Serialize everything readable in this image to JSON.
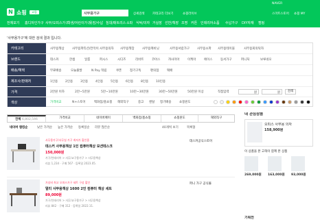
{
  "header": {
    "logo_letter": "N",
    "brand": "쇼핑",
    "badge": "쇼핑LIVE",
    "search_value": "사무용가구",
    "search_placeholder": "상품 검색",
    "links": [
      "상세검색",
      "카테고리 더보기",
      "쇼핑라이브",
      "스마트스토어"
    ],
    "user_links": [
      "NAVER",
      "쇼핑 MY"
    ]
  },
  "subnav": [
    "전체보기",
    "홈디자인가구",
    "사무/오피스가구",
    "학생/어린이가구",
    "옷장/수납",
    "침대/매트리스",
    "소파",
    "식탁/의자",
    "거실장",
    "선반/책장",
    "조명",
    "커튼",
    "인테리어소품",
    "수납가구",
    "DIY자재",
    "캠핑"
  ],
  "breadcrumb": "'사무용가구'에 대한 검색 결과 입니다.",
  "filters": [
    {
      "label": "카테고리",
      "options": [
        "사무용책상",
        "사무용파티션/칸막이",
        "사무용의자",
        "사무용책장",
        "사무용캐비닛",
        "사무용서랍가구",
        "사무용소파",
        "사무용테이블",
        "사무용회의탁자"
      ]
    },
    {
      "label": "브랜드",
      "options": [
        "데스커",
        "한샘",
        "일룸",
        "퍼시스",
        "시디즈",
        "리바트",
        "코아스",
        "까사미아",
        "이케아",
        "에이스",
        "동서가구",
        "퍼니처",
        "보루네오"
      ]
    },
    {
      "label": "배송/혜택",
      "options": [
        "무료배송",
        "오늘출발",
        "N Pay 적립",
        "쿠폰",
        "정기구독",
        "편의점",
        "택배"
      ]
    },
    {
      "label": "제조사/판매처",
      "options": [
        "1인용",
        "2인용",
        "3인용",
        "4인용",
        "5인용",
        "6인용",
        "8인용",
        "10인용"
      ]
    },
    {
      "label": "가격",
      "options": [
        "2만원 이하",
        "2만~5만원",
        "5만~10만원",
        "10만~30만원",
        "30만~50만원",
        "50만원 이상"
      ],
      "direct": "직접입력",
      "min": "원",
      "max": "원",
      "search": "검색"
    },
    {
      "label": "색상",
      "options": [
        "가격비교",
        "N+스토어",
        "백화점/홈쇼핑",
        "해외직구",
        "중고",
        "렌탈",
        "정기배송",
        "쇼핑윈도"
      ]
    }
  ],
  "colors": [
    "#ffffff",
    "#f2f2f2",
    "#ffd400",
    "#ff9900",
    "#ff0000",
    "#ff66cc",
    "#66cc33",
    "#009933",
    "#3399ff",
    "#0033cc",
    "#9933cc",
    "#663300",
    "#cc9966",
    "#999999",
    "#333333",
    "#000000"
  ],
  "tabs": [
    "전체",
    "가격비교",
    "네이버페이",
    "백화점/홈쇼핑",
    "쇼핑윈도",
    "해외직구"
  ],
  "tab_counts": [
    "6,802,546",
    "",
    "",
    "",
    "",
    ""
  ],
  "sort": [
    "네이버 랭킹순",
    "낮은 가격순",
    "높은 가격순",
    "등록일순",
    "리뷰 많은순"
  ],
  "view_options": [
    "40개씩 보기",
    "목록형"
  ],
  "items": [
    {
      "ad": "사무용가구/사무실 가구 최저가 할인중",
      "name": "데스커 사무용책상 1인 컴퓨터책상 모션데스크",
      "price": "150,000원",
      "cat": "가구/인테리어 > 사무/교구용가구 > 사무용책상",
      "meta": "리뷰 1,234 · 구매 567 · 등록일 2023.05.",
      "mall": "데스커공식스토어"
    },
    {
      "ad": "가성비 최고 오피스가구 세트 구성 할인",
      "name": "멀티 사무용책상 1600 2인 컴퓨터 책상 세트",
      "price": "89,000원",
      "cat": "가구/인테리어 > 사무/교구용가구 > 사무용책상",
      "meta": "리뷰 842 · 구매 312 · 등록일 2022.11.",
      "mall": "퍼니 가구 공식몰"
    }
  ],
  "right_panel": {
    "title": "내 관심상품",
    "product": "오피스 사무용 의자",
    "product_price": "158,900원",
    "section": "이 상품을 본 고객이 함께 본 상품",
    "items": [
      {
        "price": "269,000원"
      },
      {
        "price": "163,000원"
      },
      {
        "price": "93,000원"
      }
    ],
    "footer": "기획전"
  }
}
